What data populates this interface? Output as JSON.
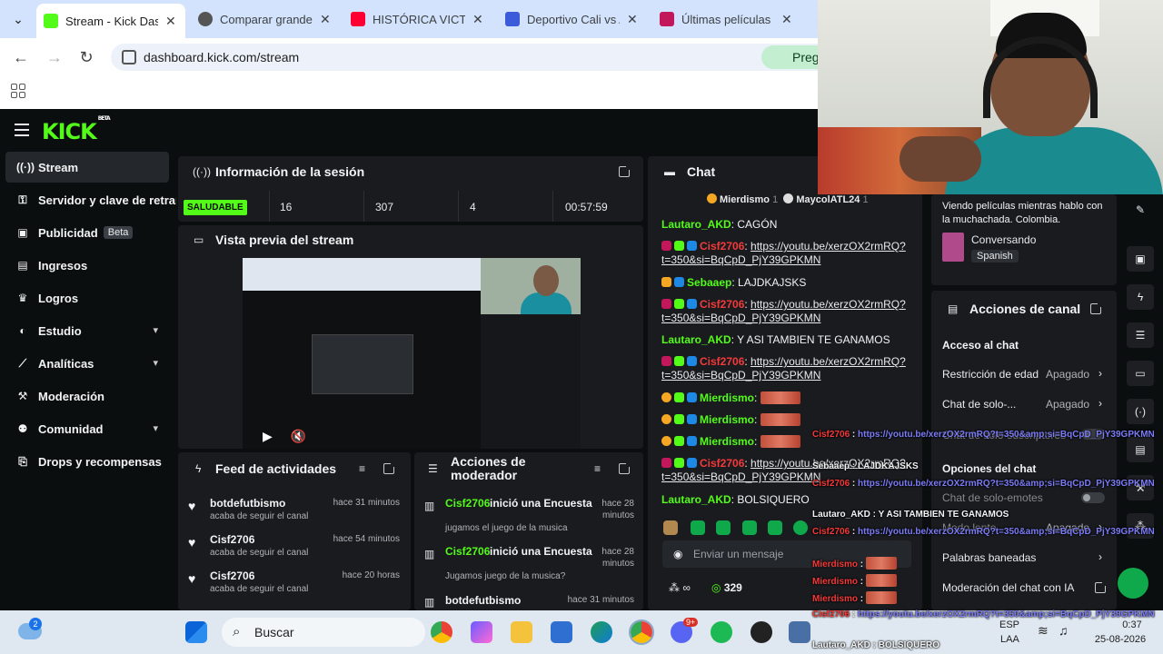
{
  "browser": {
    "tabs": [
      {
        "label": "Stream - Kick Dash",
        "color": "#53fc18"
      },
      {
        "label": "Comparar grandes",
        "color": "#444444"
      },
      {
        "label": "HISTÓRICA VICTOR",
        "color": "#ff0033"
      },
      {
        "label": "Deportivo Cali vs A",
        "color": "#3b5bdb"
      },
      {
        "label": "Últimas películas a",
        "color": "#c2185b"
      }
    ],
    "url": "dashboard.kick.com/stream",
    "ask_label": "Pregu"
  },
  "kick": {
    "logo": "KICK",
    "logo_tag": "BETA",
    "sidebar": [
      {
        "label": "Stream",
        "icon": "broadcast-icon"
      },
      {
        "label": "Servidor y clave de retrans",
        "icon": "key-icon"
      },
      {
        "label": "Publicidad",
        "icon": "ad-icon",
        "badge": "Beta"
      },
      {
        "label": "Ingresos",
        "icon": "money-icon"
      },
      {
        "label": "Logros",
        "icon": "trophy-icon"
      },
      {
        "label": "Estudio",
        "icon": "palette-icon"
      },
      {
        "label": "Analíticas",
        "icon": "chart-icon"
      },
      {
        "label": "Moderación",
        "icon": "hammer-icon"
      },
      {
        "label": "Comunidad",
        "icon": "people-icon"
      },
      {
        "label": "Drops y recompensas",
        "icon": "gift-icon"
      }
    ],
    "session": {
      "title": "Información de la sesión",
      "status": "SALUDABLE",
      "stats": [
        "16",
        "307",
        "4",
        "00:57:59"
      ]
    },
    "preview": {
      "title": "Vista previa del stream"
    },
    "feed": {
      "title": "Feed de actividades",
      "items": [
        {
          "name": "botdefutbismo",
          "sub": "acaba de seguir el canal",
          "time": "hace 31 minutos"
        },
        {
          "name": "Cisf2706",
          "sub": "acaba de seguir el canal",
          "time": "hace 54 minutos"
        },
        {
          "name": "Cisf2706",
          "sub": "acaba de seguir el canal",
          "time": "hace 20 horas"
        }
      ]
    },
    "modactions": {
      "title": "Acciones de moderador",
      "items": [
        {
          "name": "Cisf2706",
          "action": "inició una Encuesta",
          "sub": "jugamos el juego de la musica",
          "time": "hace 28 minutos"
        },
        {
          "name": "Cisf2706",
          "action": "inició una Encuesta",
          "sub": "Jugamos juego de la musica?",
          "time": "hace 28 minutos"
        },
        {
          "name": "botdefutbismo",
          "action": "",
          "sub": "",
          "time": "hace 31 minutos"
        }
      ]
    },
    "chat": {
      "title": "Chat",
      "top_users": [
        "Mierdismo",
        "1",
        "MaycolATL24",
        "1"
      ],
      "messages": [
        {
          "user": "Lautaro_AKD",
          "text": "CAGÓN"
        },
        {
          "user": "Cisf2706",
          "text": "https://youtu.be/xerzOX2rmRQ?t=350&si=BqCpD_PjY39GPKMN"
        },
        {
          "user": "Sebaaep",
          "text": "LAJDKAJSKS"
        },
        {
          "user": "Cisf2706",
          "text": "https://youtu.be/xerzOX2rmRQ?t=350&si=BqCpD_PjY39GPKMN"
        },
        {
          "user": "Lautaro_AKD",
          "text": "Y ASI TAMBIEN TE GANAMOS"
        },
        {
          "user": "Cisf2706",
          "text": "https://youtu.be/xerzOX2rmRQ?t=350&si=BqCpD_PjY39GPKMN"
        },
        {
          "user": "Mierdismo",
          "text": ""
        },
        {
          "user": "Mierdismo",
          "text": ""
        },
        {
          "user": "Mierdismo",
          "text": ""
        },
        {
          "user": "Cisf2706",
          "text": "https://youtu.be/xerzOX2rmRQ?t=350&si=BqCpD_PjY39GPKMN"
        },
        {
          "user": "Lautaro_AKD",
          "text": "BOLSIQUERO"
        }
      ],
      "input_placeholder": "Enviar un mensaje",
      "infinity": "∞",
      "points": "329"
    },
    "stream_info": {
      "title_text": "Viendo películas mientras hablo con la muchachada. Colombia.",
      "category": "Conversando",
      "language": "Spanish"
    },
    "channel_actions": {
      "title": "Acciones de canal",
      "section": "Acceso al chat",
      "rows": [
        {
          "label": "Restricción de edad",
          "value": "Apagado"
        },
        {
          "label": "Chat de solo-...",
          "value": "Apagado"
        },
        {
          "label": "Chat de solo-suscriptores",
          "value": ""
        },
        {
          "label": "Opciones del chat",
          "value": ""
        },
        {
          "label": "Chat de solo-emotes",
          "value": ""
        },
        {
          "label": "Modo lento",
          "value": "Apagado"
        },
        {
          "label": "Palabras baneadas",
          "value": ""
        },
        {
          "label": "Moderación del chat con IA",
          "value": ""
        }
      ]
    }
  },
  "overlay_chat": [
    {
      "user": "Cisf2706",
      "text": "https://youtu.be/xerzOX2rmRQ?t=350&amp;si=BqCpD_PjY39GPKMN"
    },
    {
      "user": "Sebaaep",
      "text": "LAJDKAJSKS"
    },
    {
      "user": "Cisf2706",
      "text": "https://youtu.be/xerzOX2rmRQ?t=350&amp;si=BqCpD_PjY39GPKMN"
    },
    {
      "user": "Lautaro_AKD",
      "text": "Y ASI TAMBIEN TE GANAMOS"
    },
    {
      "user": "Cisf2706",
      "text": "https://youtu.be/xerzOX2rmRQ?t=350&amp;si=BqCpD_PjY39GPKMN"
    },
    {
      "user": "Mierdismo",
      "text": ""
    },
    {
      "user": "Mierdismo",
      "text": ""
    },
    {
      "user": "Mierdismo",
      "text": ""
    },
    {
      "user": "Cisf2706",
      "text": "https://youtu.be/xerzOX2rmRQ?t=350&amp;si=BqCpD_PjY39GPKMN"
    },
    {
      "user": "Lautaro_AKD",
      "text": "BOLSIQUERO"
    }
  ],
  "taskbar": {
    "search": "Buscar",
    "weather_badge": "2",
    "notif_badge": "9+",
    "lang": "ESP",
    "layout": "LAA",
    "time": "0:37",
    "date": "25-08-2026"
  }
}
